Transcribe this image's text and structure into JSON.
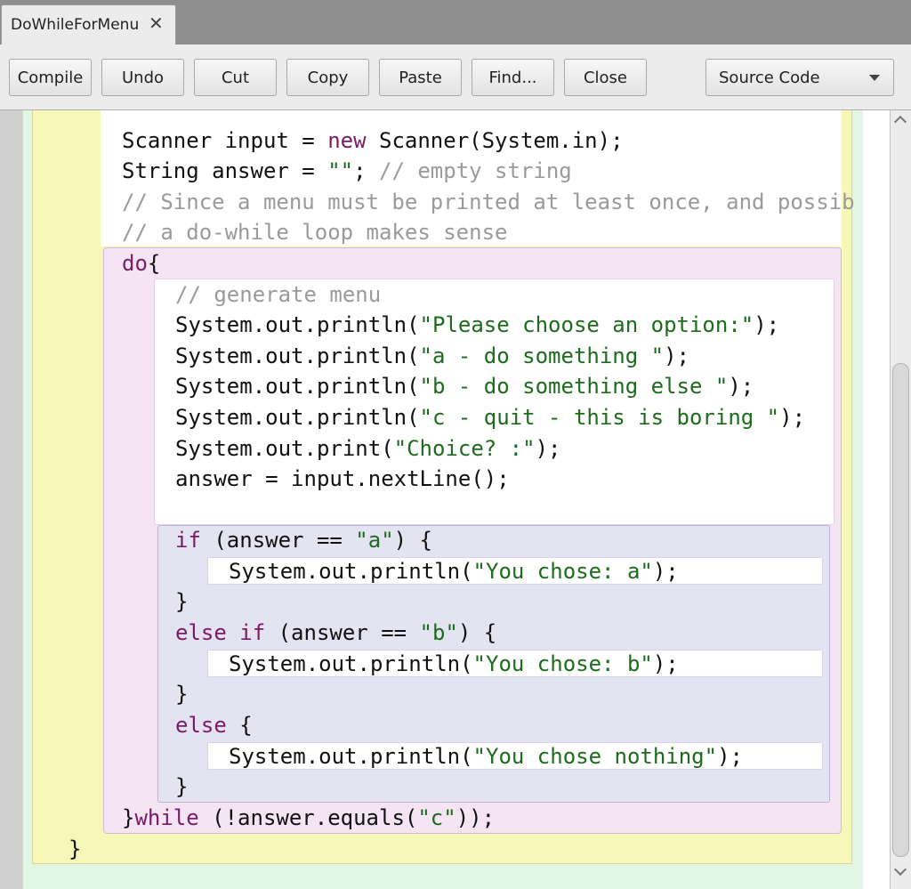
{
  "tab": {
    "title": "DoWhileForMenu",
    "close": "✕"
  },
  "toolbar": {
    "compile": "Compile",
    "undo": "Undo",
    "cut": "Cut",
    "copy": "Copy",
    "paste": "Paste",
    "find": "Find...",
    "close": "Close",
    "view_select": "Source Code"
  },
  "code": {
    "lines": [
      [
        [
          "",
          "Scanner input = "
        ],
        [
          "kw",
          "new"
        ],
        [
          "",
          " Scanner(System.in);"
        ]
      ],
      [
        [
          "",
          "String answer = "
        ],
        [
          "str",
          "\"\""
        ],
        [
          "",
          "; "
        ],
        [
          "cm",
          "// empty string"
        ]
      ],
      [
        [
          "cm",
          "// Since a menu must be printed at least once, and possib"
        ]
      ],
      [
        [
          "cm",
          "// a do-while loop makes sense"
        ]
      ],
      [
        [
          "kw",
          "do"
        ],
        [
          "",
          "{"
        ]
      ],
      [
        [
          "cm",
          "// generate menu"
        ]
      ],
      [
        [
          "",
          "System.out.println("
        ],
        [
          "str",
          "\"Please choose an option:\""
        ],
        [
          "",
          ");"
        ]
      ],
      [
        [
          "",
          "System.out.println("
        ],
        [
          "str",
          "\"a - do something \""
        ],
        [
          "",
          ");"
        ]
      ],
      [
        [
          "",
          "System.out.println("
        ],
        [
          "str",
          "\"b - do something else \""
        ],
        [
          "",
          ");"
        ]
      ],
      [
        [
          "",
          "System.out.println("
        ],
        [
          "str",
          "\"c - quit - this is boring \""
        ],
        [
          "",
          ");"
        ]
      ],
      [
        [
          "",
          "System.out.print("
        ],
        [
          "str",
          "\"Choice? :\""
        ],
        [
          "",
          ");"
        ]
      ],
      [
        [
          "",
          "answer = input.nextLine();"
        ]
      ],
      [
        [
          "kw",
          "if"
        ],
        [
          "",
          " (answer == "
        ],
        [
          "str",
          "\"a\""
        ],
        [
          "",
          ") {"
        ]
      ],
      [
        [
          "",
          "System.out.println("
        ],
        [
          "str",
          "\"You chose: a\""
        ],
        [
          "",
          ");"
        ]
      ],
      [
        [
          "",
          "}"
        ]
      ],
      [
        [
          "kw",
          "else if"
        ],
        [
          "",
          " (answer == "
        ],
        [
          "str",
          "\"b\""
        ],
        [
          "",
          ") {"
        ]
      ],
      [
        [
          "",
          "System.out.println("
        ],
        [
          "str",
          "\"You chose: b\""
        ],
        [
          "",
          ");"
        ]
      ],
      [
        [
          "",
          "}"
        ]
      ],
      [
        [
          "kw",
          "else"
        ],
        [
          "",
          " {"
        ]
      ],
      [
        [
          "",
          "System.out.println("
        ],
        [
          "str",
          "\"You chose nothing\""
        ],
        [
          "",
          ");"
        ]
      ],
      [
        [
          "",
          "}"
        ]
      ],
      [
        [
          "",
          "}"
        ],
        [
          "kw",
          "while"
        ],
        [
          "",
          " (!answer.equals("
        ],
        [
          "str",
          "\"c\""
        ],
        [
          "",
          "));"
        ]
      ],
      [
        [
          "",
          "}"
        ]
      ]
    ]
  }
}
